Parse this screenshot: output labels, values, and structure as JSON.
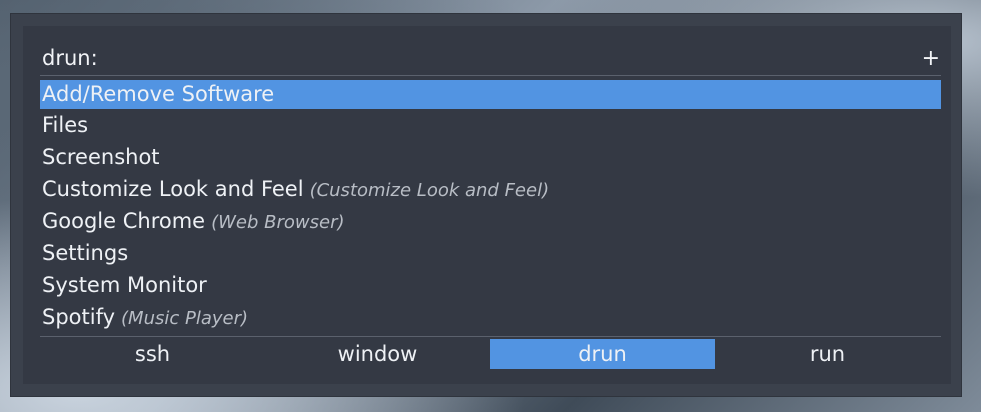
{
  "prompt": {
    "label": "drun:",
    "plus": "+"
  },
  "items": [
    {
      "name": "Add/Remove Software",
      "sub": "",
      "selected": true
    },
    {
      "name": "Files",
      "sub": ""
    },
    {
      "name": "Screenshot",
      "sub": ""
    },
    {
      "name": "Customize Look and Feel",
      "sub": "(Customize Look and Feel)"
    },
    {
      "name": "Google Chrome",
      "sub": "(Web Browser)"
    },
    {
      "name": "Settings",
      "sub": ""
    },
    {
      "name": "System Monitor",
      "sub": ""
    },
    {
      "name": "Spotify",
      "sub": "(Music Player)"
    }
  ],
  "modes": [
    {
      "label": "ssh"
    },
    {
      "label": "window"
    },
    {
      "label": "drun",
      "active": true
    },
    {
      "label": "run"
    }
  ],
  "colors": {
    "accent": "#5294e2",
    "window_bg": "#3b414c",
    "panel_bg": "#343944",
    "text": "#eef1f5",
    "subtext": "#b8bdc5"
  }
}
